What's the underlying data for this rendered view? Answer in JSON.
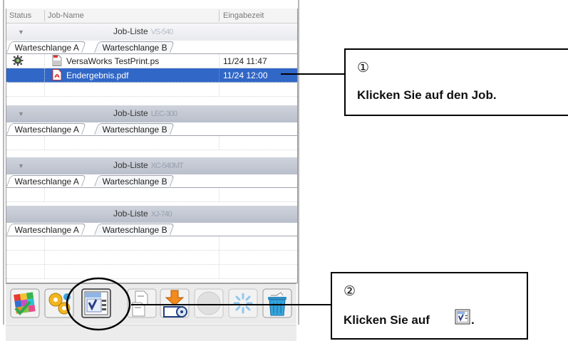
{
  "columns": {
    "status": "Status",
    "job_name": "Job-Name",
    "input_time": "Eingabezeit"
  },
  "groups": [
    {
      "title": "Job-Liste",
      "model": "VS-540",
      "tab_a": "Warteschlange A",
      "tab_b": "Warteschlange B",
      "jobs": [
        {
          "name": "VersaWorks TestPrint.ps",
          "time": "11/24 11:47",
          "status_icon": "gear-icon",
          "file_icon": "ps-file-icon",
          "selected": false
        },
        {
          "name": "Endergebnis.pdf",
          "time": "11/24 12:00",
          "status_icon": "",
          "file_icon": "pdf-file-icon",
          "selected": true
        }
      ]
    },
    {
      "title": "Job-Liste",
      "model": "LEC-300",
      "tab_a": "Warteschlange A",
      "tab_b": "Warteschlange B",
      "jobs": []
    },
    {
      "title": "Job-Liste",
      "model": "XC-540MT",
      "tab_a": "Warteschlange A",
      "tab_b": "Warteschlange B",
      "jobs": []
    },
    {
      "title": "Job-Liste",
      "model": "XJ-740",
      "tab_a": "Warteschlange A",
      "tab_b": "Warteschlange B",
      "jobs": []
    }
  ],
  "toolbar": {
    "buttons": [
      {
        "icon": "color-check-icon"
      },
      {
        "icon": "settings-gear-icon"
      },
      {
        "icon": "job-settings-icon"
      },
      {
        "icon": "copy-job-icon"
      },
      {
        "icon": "print-to-disk-icon"
      },
      {
        "icon": "disabled-circle-icon"
      },
      {
        "icon": "cancel-spinner-icon"
      },
      {
        "icon": "trash-bin-icon"
      }
    ]
  },
  "callouts": [
    {
      "number": "①",
      "text": "Klicken Sie auf den Job."
    },
    {
      "number": "②",
      "text": "Klicken Sie auf",
      "suffix": ".",
      "inline_icon": "job-settings-icon"
    }
  ],
  "colors": {
    "selection": "#3167c6",
    "group_header_dark": "#c3c8d2",
    "group_header_light": "#eef0f3"
  }
}
